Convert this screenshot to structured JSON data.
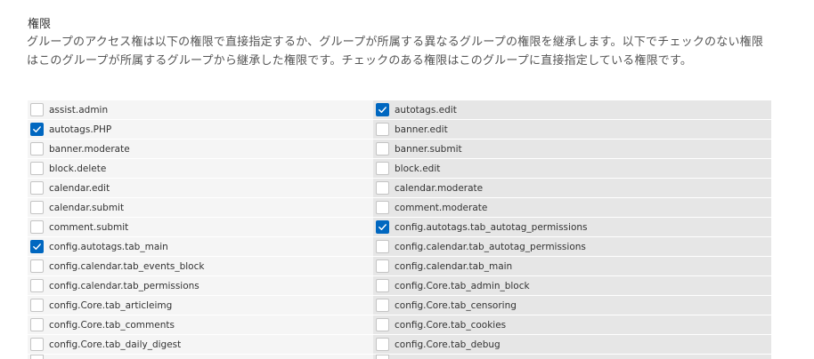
{
  "section": {
    "title": "権限",
    "description": "グループのアクセス権は以下の権限で直接指定するか、グループが所属する異なるグループの権限を継承します。以下でチェックのない権限はこのグループが所属するグループから継承した権限です。チェックのある権限はこのグループに直接指定している権限です。"
  },
  "permissions": [
    {
      "left": {
        "label": "assist.admin",
        "checked": false
      },
      "right": {
        "label": "autotags.edit",
        "checked": true
      }
    },
    {
      "left": {
        "label": "autotags.PHP",
        "checked": true
      },
      "right": {
        "label": "banner.edit",
        "checked": false
      }
    },
    {
      "left": {
        "label": "banner.moderate",
        "checked": false
      },
      "right": {
        "label": "banner.submit",
        "checked": false
      }
    },
    {
      "left": {
        "label": "block.delete",
        "checked": false
      },
      "right": {
        "label": "block.edit",
        "checked": false
      }
    },
    {
      "left": {
        "label": "calendar.edit",
        "checked": false
      },
      "right": {
        "label": "calendar.moderate",
        "checked": false
      }
    },
    {
      "left": {
        "label": "calendar.submit",
        "checked": false
      },
      "right": {
        "label": "comment.moderate",
        "checked": false
      }
    },
    {
      "left": {
        "label": "comment.submit",
        "checked": false
      },
      "right": {
        "label": "config.autotags.tab_autotag_permissions",
        "checked": true
      }
    },
    {
      "left": {
        "label": "config.autotags.tab_main",
        "checked": true
      },
      "right": {
        "label": "config.calendar.tab_autotag_permissions",
        "checked": false
      }
    },
    {
      "left": {
        "label": "config.calendar.tab_events_block",
        "checked": false
      },
      "right": {
        "label": "config.calendar.tab_main",
        "checked": false
      }
    },
    {
      "left": {
        "label": "config.calendar.tab_permissions",
        "checked": false
      },
      "right": {
        "label": "config.Core.tab_admin_block",
        "checked": false
      }
    },
    {
      "left": {
        "label": "config.Core.tab_articleimg",
        "checked": false
      },
      "right": {
        "label": "config.Core.tab_censoring",
        "checked": false
      }
    },
    {
      "left": {
        "label": "config.Core.tab_comments",
        "checked": false
      },
      "right": {
        "label": "config.Core.tab_cookies",
        "checked": false
      }
    },
    {
      "left": {
        "label": "config.Core.tab_daily_digest",
        "checked": false
      },
      "right": {
        "label": "config.Core.tab_debug",
        "checked": false
      }
    }
  ],
  "icons": {
    "check": "checkmark-icon"
  },
  "colors": {
    "accent": "#0067c0",
    "row_left": "#f5f5f5",
    "row_right": "#e6e6e6"
  }
}
